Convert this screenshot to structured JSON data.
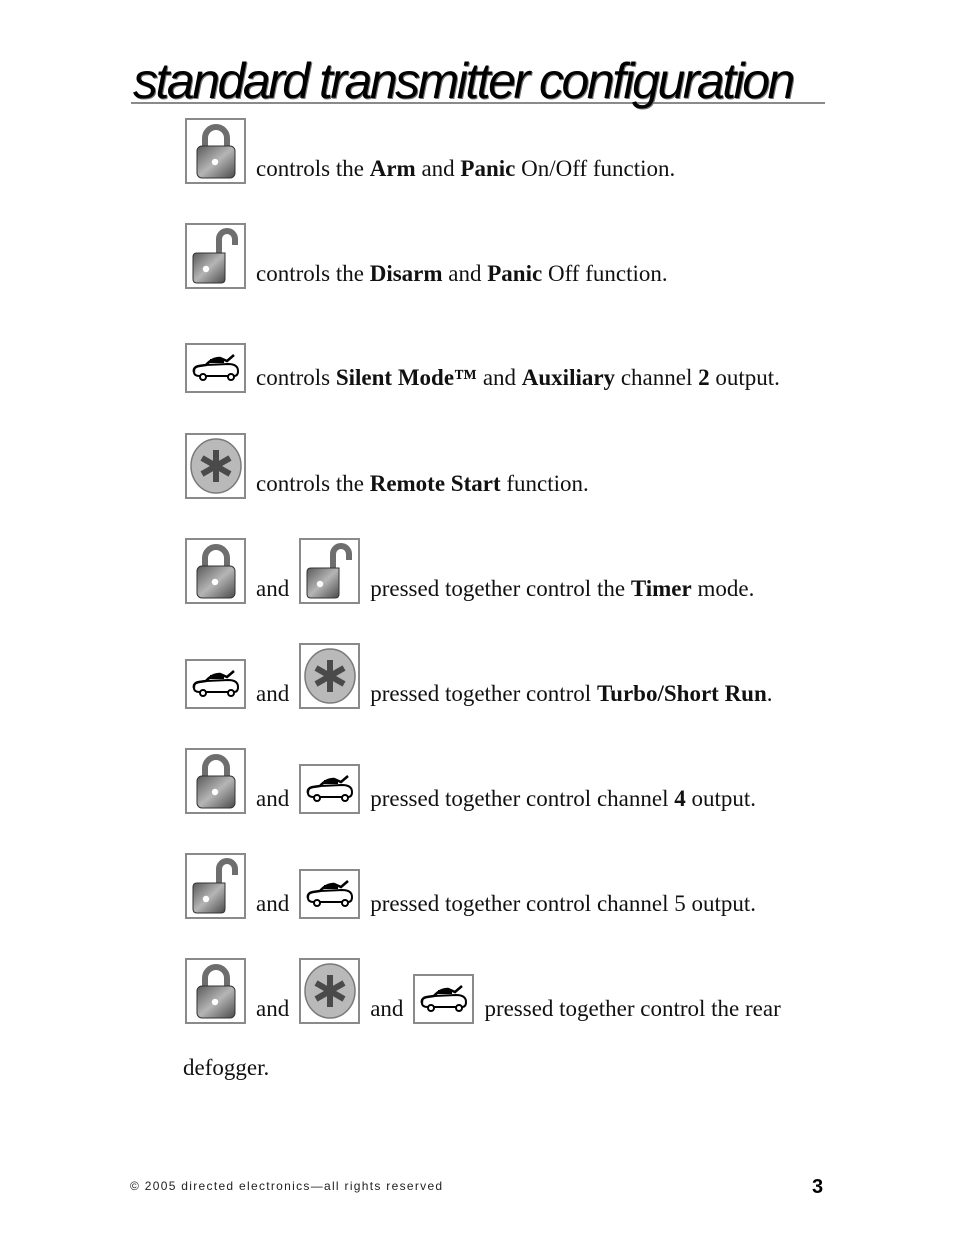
{
  "page": {
    "title": "standard transmitter configuration",
    "footer": "© 2005 directed electronics—all rights reserved",
    "page_number": "3"
  },
  "icons": {
    "lock": "lock-icon",
    "unlock": "unlock-icon",
    "trunk": "car-trunk-icon",
    "star": "asterisk-remote-start-icon"
  },
  "rows": [
    {
      "buttons": [
        "lock"
      ],
      "text": [
        {
          "t": "controls the "
        },
        {
          "t": "Arm",
          "b": true
        },
        {
          "t": " and "
        },
        {
          "t": "Panic",
          "b": true
        },
        {
          "t": " On/Off function."
        }
      ]
    },
    {
      "buttons": [
        "unlock"
      ],
      "text": [
        {
          "t": "controls the "
        },
        {
          "t": "Disarm",
          "b": true
        },
        {
          "t": " and "
        },
        {
          "t": "Panic",
          "b": true
        },
        {
          "t": " Off function."
        }
      ]
    },
    {
      "buttons": [
        "trunk"
      ],
      "text": [
        {
          "t": "controls "
        },
        {
          "t": "Silent Mode™",
          "b": true
        },
        {
          "t": " and "
        },
        {
          "t": "Auxiliary",
          "b": true
        },
        {
          "t": " channel "
        },
        {
          "t": "2",
          "b": true
        },
        {
          "t": " output."
        }
      ]
    },
    {
      "buttons": [
        "star"
      ],
      "text": [
        {
          "t": "controls the "
        },
        {
          "t": "Remote Start",
          "b": true
        },
        {
          "t": " function."
        }
      ]
    },
    {
      "buttons": [
        "lock",
        "unlock"
      ],
      "text": [
        {
          "t": "pressed together control the "
        },
        {
          "t": "Timer",
          "b": true
        },
        {
          "t": " mode."
        }
      ]
    },
    {
      "buttons": [
        "trunk",
        "star"
      ],
      "text": [
        {
          "t": "pressed together control "
        },
        {
          "t": "Turbo/Short Run",
          "b": true
        },
        {
          "t": "."
        }
      ]
    },
    {
      "buttons": [
        "lock",
        "trunk"
      ],
      "text": [
        {
          "t": "pressed together control channel "
        },
        {
          "t": "4",
          "b": true
        },
        {
          "t": " output."
        }
      ]
    },
    {
      "buttons": [
        "unlock",
        "trunk"
      ],
      "text": [
        {
          "t": "pressed together control channel 5 output."
        }
      ]
    },
    {
      "buttons": [
        "lock",
        "star",
        "trunk"
      ],
      "text": [
        {
          "t": "pressed together control the rear"
        }
      ]
    }
  ],
  "connector": "and",
  "tail_text": "defogger."
}
